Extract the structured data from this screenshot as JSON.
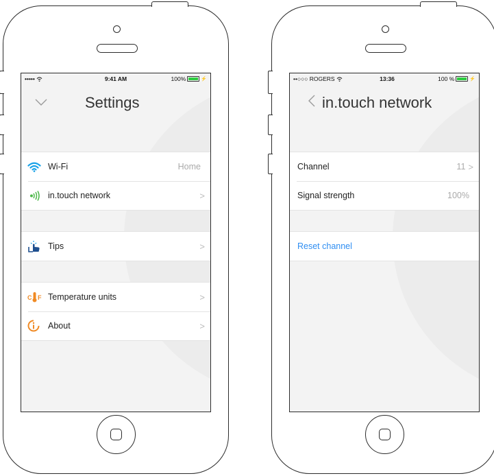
{
  "left_phone": {
    "status": {
      "carrier": "•••••",
      "time": "9:41 AM",
      "battery": "100%"
    },
    "title": "Settings",
    "groups": [
      [
        {
          "label": "Wi-Fi",
          "value": "Home",
          "icon": "wifi-icon"
        },
        {
          "label": "in.touch network",
          "value": "",
          "icon": "signal-waves-icon"
        }
      ],
      [
        {
          "label": "Tips",
          "value": "",
          "icon": "hand-touch-icon"
        }
      ],
      [
        {
          "label": "Temperature units",
          "value": "",
          "icon": "thermometer-cf-icon"
        },
        {
          "label": "About",
          "value": "",
          "icon": "info-icon"
        }
      ]
    ]
  },
  "right_phone": {
    "status": {
      "carrier": "••○○○ ROGERS",
      "time": "13:36",
      "battery": "100 %"
    },
    "title": "in.touch network",
    "rows": [
      {
        "label": "Channel",
        "value": "11"
      },
      {
        "label": "Signal strength",
        "value": "100%"
      }
    ],
    "reset_label": "Reset channel"
  },
  "colors": {
    "accent_blue": "#2f8ef2",
    "icon_orange": "#f08a24",
    "wifi_blue": "#1aa3e8",
    "signal_green": "#4cb848"
  }
}
